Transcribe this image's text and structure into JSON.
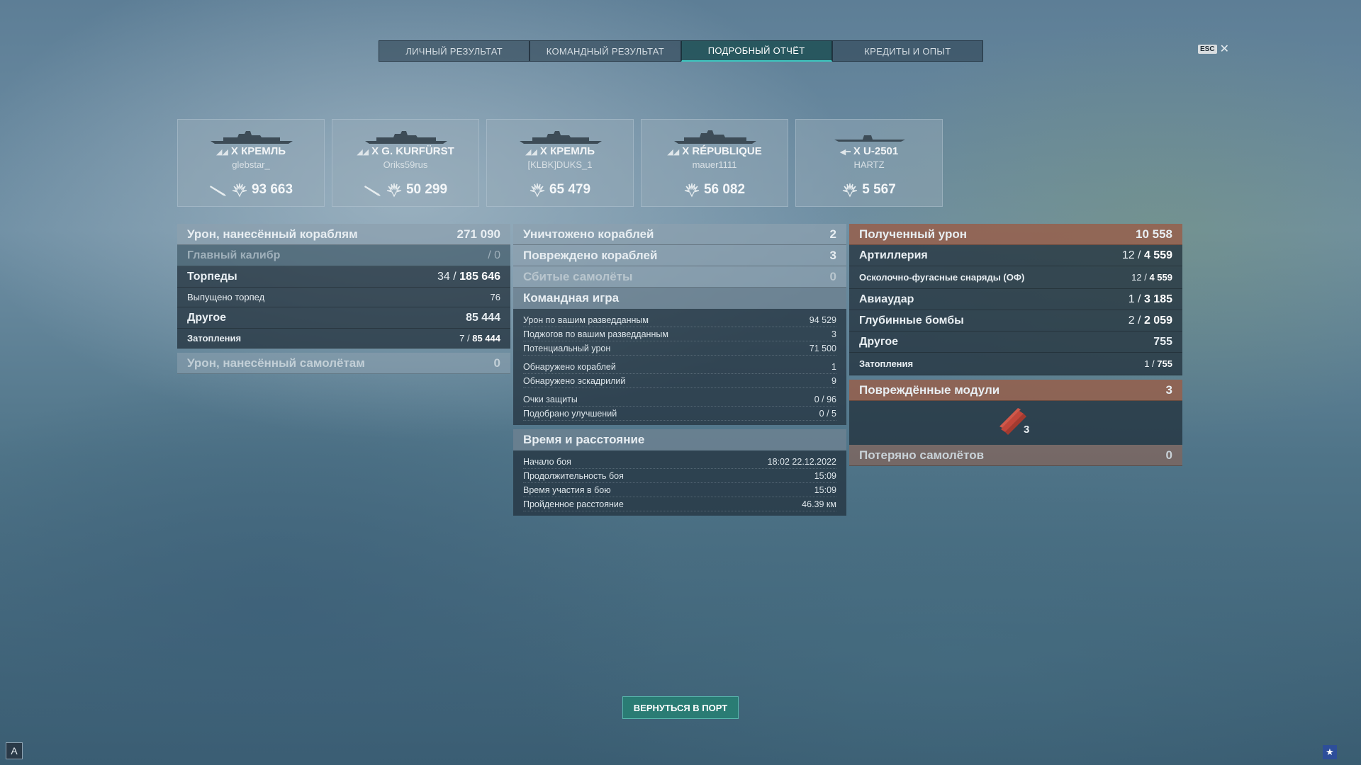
{
  "tabs": [
    {
      "label": "ЛИЧНЫЙ РЕЗУЛЬТАТ"
    },
    {
      "label": "КОМАНДНЫЙ РЕЗУЛЬТАТ"
    },
    {
      "label": "ПОДРОБНЫЙ ОТЧЁТ"
    },
    {
      "label": "КРЕДИТЫ И ОПЫТ"
    }
  ],
  "active_tab": "ПОДРОБНЫЙ ОТЧЁТ",
  "esc": {
    "badge": "ESC",
    "close": "✕"
  },
  "ships": [
    {
      "tier": "X",
      "name": "КРЕМЛЬ",
      "player": "glebstar_",
      "damage": "93 663",
      "has_torpedo_icon": true
    },
    {
      "tier": "X",
      "name": "G. KURFÜRST",
      "player": "Oriks59rus",
      "damage": "50 299",
      "has_torpedo_icon": true
    },
    {
      "tier": "X",
      "name": "КРЕМЛЬ",
      "player": "[KLBK]DUKS_1",
      "damage": "65 479",
      "has_torpedo_icon": false
    },
    {
      "tier": "X",
      "name": "RÉPUBLIQUE",
      "player": "mauer1111",
      "damage": "56 082",
      "has_torpedo_icon": false
    },
    {
      "tier": "X",
      "name": "U-2501",
      "player": "HARTZ",
      "damage": "5 567",
      "has_torpedo_icon": false
    }
  ],
  "left": {
    "ship_damage": {
      "label": "Урон, нанесённый кораблям",
      "value": "271 090"
    },
    "main_caliber": {
      "label": "Главный калибр",
      "value": "/ 0"
    },
    "torpedoes": {
      "label": "Торпеды",
      "hits": "34 /",
      "value": "185 646"
    },
    "torpedoes_fired": {
      "label": "Выпущено торпед",
      "value": "76"
    },
    "other": {
      "label": "Другое",
      "value": "85 444"
    },
    "flooding": {
      "label": "Затопления",
      "hits": "7 /",
      "value": "85 444"
    },
    "plane_damage": {
      "label": "Урон, нанесённый самолётам",
      "value": "0"
    }
  },
  "middle": {
    "destroyed": {
      "label": "Уничтожено кораблей",
      "value": "2"
    },
    "damaged": {
      "label": "Повреждено кораблей",
      "value": "3"
    },
    "planes_shot": {
      "label": "Сбитые самолёты",
      "value": "0"
    },
    "team_title": "Командная игра",
    "team_items": [
      {
        "label": "Урон по вашим разведданным",
        "value": "94 529"
      },
      {
        "label": "Поджогов по вашим разведданным",
        "value": "3"
      },
      {
        "label": "Потенциальный урон",
        "value": "71 500"
      }
    ],
    "spot_items": [
      {
        "label": "Обнаружено кораблей",
        "value": "1"
      },
      {
        "label": "Обнаружено эскадрилий",
        "value": "9"
      }
    ],
    "cap_items": [
      {
        "label": "Очки защиты",
        "value": "0 / 96"
      },
      {
        "label": "Подобрано улучшений",
        "value": "0 / 5"
      }
    ],
    "time_title": "Время и расстояние",
    "time_items": [
      {
        "label": "Начало боя",
        "value": "18:02  22.12.2022"
      },
      {
        "label": "Продолжительность боя",
        "value": "15:09"
      },
      {
        "label": "Время участия в бою",
        "value": "15:09"
      },
      {
        "label": "Пройденное расстояние",
        "value": "46.39 км"
      }
    ]
  },
  "right": {
    "received": {
      "label": "Полученный урон",
      "value": "10 558"
    },
    "artillery": {
      "label": "Артиллерия",
      "hits": "12 /",
      "value": "4 559"
    },
    "he_shells": {
      "label": "Осколочно-фугасные снаряды (ОФ)",
      "hits": "12 /",
      "value": "4 559"
    },
    "air_strike": {
      "label": "Авиаудар",
      "hits": "1 /",
      "value": "3 185"
    },
    "depth_charges": {
      "label": "Глубинные бомбы",
      "hits": "2 /",
      "value": "2 059"
    },
    "other": {
      "label": "Другое",
      "value": "755"
    },
    "flooding": {
      "label": "Затопления",
      "hits": "1 /",
      "value": "755"
    },
    "modules": {
      "label": "Повреждённые модули",
      "value": "3"
    },
    "module_count": "3",
    "planes_lost": {
      "label": "Потеряно самолётов",
      "value": "0"
    }
  },
  "back_button": "ВЕРНУТЬСЯ В ПОРТ",
  "corner_left_glyph": "A",
  "corner_right_glyph": "★"
}
